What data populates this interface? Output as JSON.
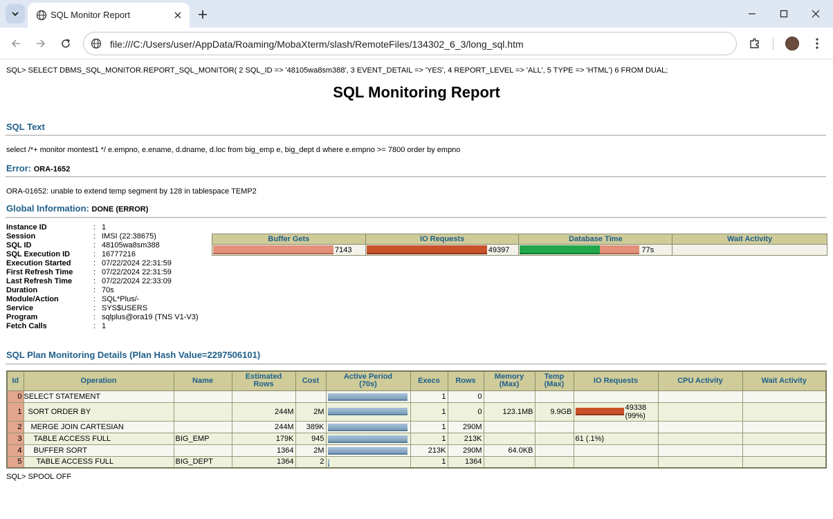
{
  "browser": {
    "tab_title": "SQL Monitor Report",
    "url": "file:///C:/Users/user/AppData/Roaming/MobaXterm/slash/RemoteFiles/134302_6_3/long_sql.htm"
  },
  "page": {
    "sql_command": "SQL> SELECT DBMS_SQL_MONITOR.REPORT_SQL_MONITOR( 2 SQL_ID => '48105wa8sm388', 3 EVENT_DETAIL => 'YES', 4 REPORT_LEVEL => 'ALL', 5 TYPE => 'HTML') 6 FROM DUAL;",
    "report_title": "SQL Monitoring Report",
    "sql_text_heading": "SQL Text",
    "sql_text": "select /*+ monitor montest1 */ e.empno, e.ename, d.dname, d.loc from big_emp e, big_dept d where e.empno >= 7800 order by empno",
    "error_heading": "Error:",
    "error_code": "ORA-1652",
    "error_message": "ORA-01652: unable to extend temp segment by 128 in tablespace TEMP2",
    "global_heading": "Global Information:",
    "global_status": "DONE (ERROR)",
    "global_info": [
      {
        "label": "Instance ID",
        "value": "1"
      },
      {
        "label": "Session",
        "value": "IMSI (22:38675)"
      },
      {
        "label": "SQL ID",
        "value": "48105wa8sm388"
      },
      {
        "label": "SQL Execution ID",
        "value": "16777216"
      },
      {
        "label": "Execution Started",
        "value": "07/22/2024 22:31:59"
      },
      {
        "label": "First Refresh Time",
        "value": "07/22/2024 22:31:59"
      },
      {
        "label": "Last Refresh Time",
        "value": "07/22/2024 22:33:09"
      },
      {
        "label": "Duration",
        "value": "70s"
      },
      {
        "label": "Module/Action",
        "value": "SQL*Plus/-"
      },
      {
        "label": "Service",
        "value": "SYS$USERS"
      },
      {
        "label": "Program",
        "value": "sqlplus@ora19 (TNS V1-V3)"
      },
      {
        "label": "Fetch Calls",
        "value": "1"
      }
    ],
    "metrics": {
      "headers": [
        "Buffer Gets",
        "IO Requests",
        "Database Time",
        "Wait Activity"
      ],
      "buffer_gets": "7143",
      "io_requests": "49397",
      "database_time": "77s"
    },
    "plan_heading": "SQL Plan Monitoring Details (Plan Hash Value=2297506101)",
    "plan_headers": [
      "Id",
      "Operation",
      "Name",
      "Estimated\nRows",
      "Cost",
      "Active Period\n(70s)",
      "Execs",
      "Rows",
      "Memory\n(Max)",
      "Temp\n(Max)",
      "IO Requests",
      "CPU Activity",
      "Wait Activity"
    ],
    "plan_rows": [
      {
        "id": "0",
        "operation": "SELECT STATEMENT",
        "name": "",
        "est_rows": "",
        "cost": "",
        "execs": "1",
        "rows": "0",
        "memory": "",
        "temp": "",
        "io": ""
      },
      {
        "id": "1",
        "operation": "SORT ORDER BY",
        "name": "",
        "est_rows": "244M",
        "cost": "2M",
        "execs": "1",
        "rows": "0",
        "memory": "123.1MB",
        "temp": "9.9GB",
        "io": "49338",
        "io_pct": "(99%)"
      },
      {
        "id": "2",
        "operation": "MERGE JOIN CARTESIAN",
        "name": "",
        "est_rows": "244M",
        "cost": "389K",
        "execs": "1",
        "rows": "290M",
        "memory": "",
        "temp": "",
        "io": ""
      },
      {
        "id": "3",
        "operation": "TABLE ACCESS FULL",
        "name": "BIG_EMP",
        "est_rows": "179K",
        "cost": "945",
        "execs": "1",
        "rows": "213K",
        "memory": "",
        "temp": "",
        "io": "61 (.1%)"
      },
      {
        "id": "4",
        "operation": "BUFFER SORT",
        "name": "",
        "est_rows": "1364",
        "cost": "2M",
        "execs": "213K",
        "rows": "290M",
        "memory": "64.0KB",
        "temp": "",
        "io": ""
      },
      {
        "id": "5",
        "operation": "TABLE ACCESS FULL",
        "name": "BIG_DEPT",
        "est_rows": "1364",
        "cost": "2",
        "execs": "1",
        "rows": "1364",
        "memory": "",
        "temp": "",
        "io": ""
      }
    ],
    "spool": "SQL> SPOOL OFF"
  },
  "colors": {
    "heading": "#1f5f8b",
    "header_bg": "#cfcc9a",
    "io_bar": "#c9522a",
    "db_time_cpu": "#22a84a",
    "buffer_bar": "#e2907a"
  }
}
